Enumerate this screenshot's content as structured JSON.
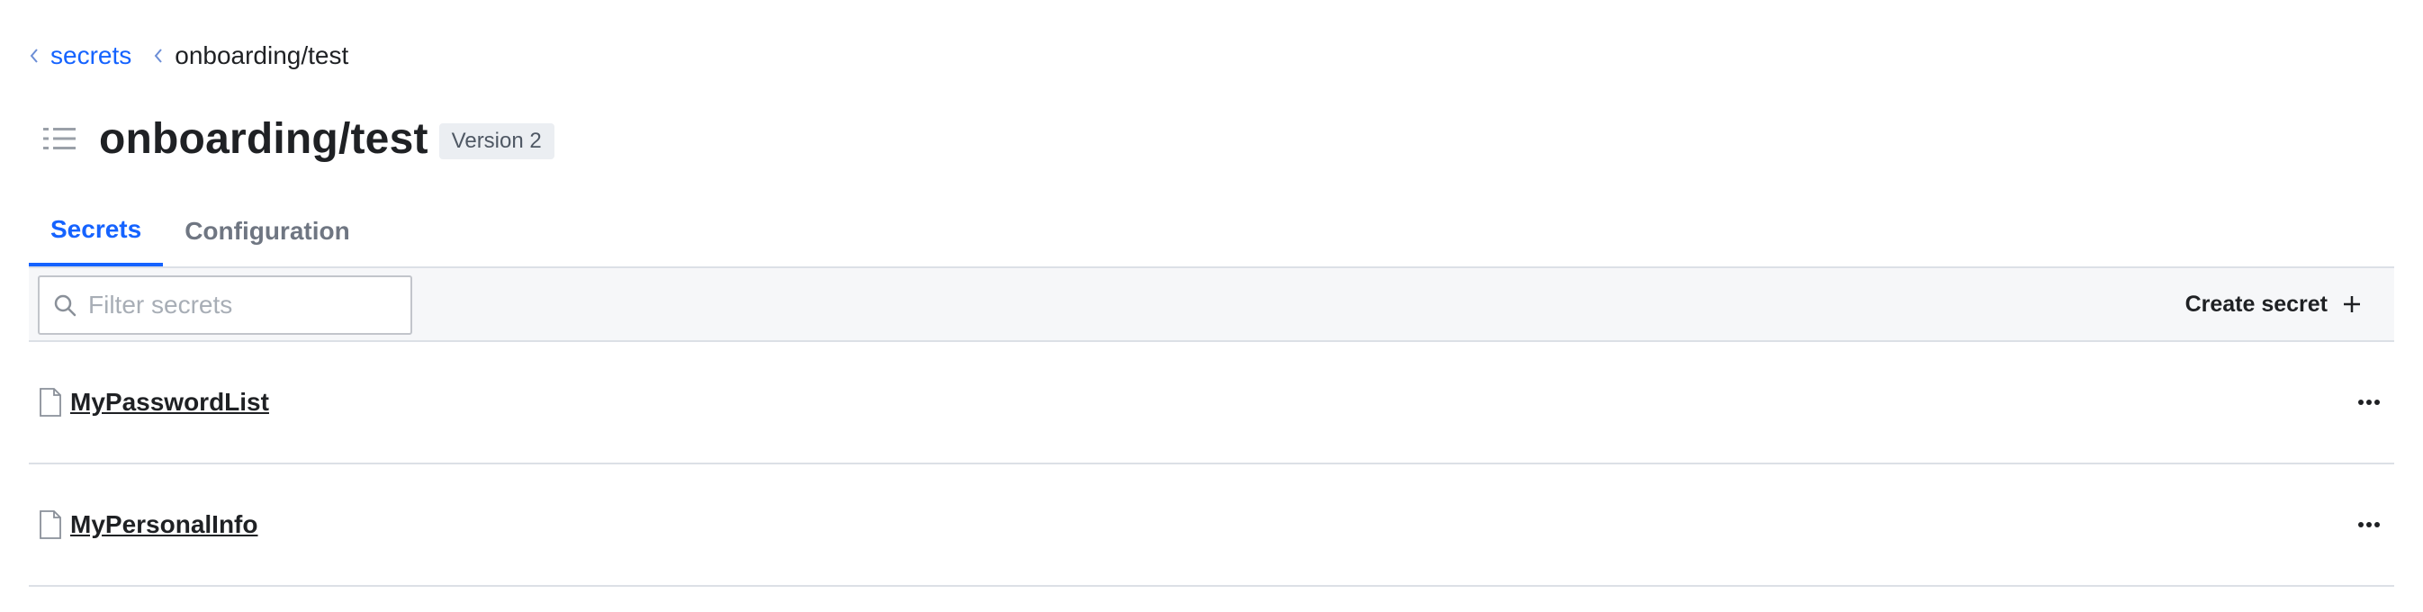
{
  "breadcrumb": {
    "items": [
      {
        "label": "secrets",
        "link": true
      },
      {
        "label": "onboarding/test",
        "link": false
      }
    ]
  },
  "header": {
    "title": "onboarding/test",
    "version_badge": "Version 2",
    "icon": "list-icon"
  },
  "tabs": [
    {
      "label": "Secrets",
      "active": true
    },
    {
      "label": "Configuration",
      "active": false
    }
  ],
  "toolbar": {
    "search_placeholder": "Filter secrets",
    "search_value": "",
    "create_label": "Create secret",
    "create_icon": "plus-icon"
  },
  "secrets": [
    {
      "name": "MyPasswordList",
      "icon": "file-icon"
    },
    {
      "name": "MyPersonalInfo",
      "icon": "file-icon"
    }
  ],
  "colors": {
    "accent": "#1563ff",
    "text": "#1f2124",
    "muted": "#6f7682",
    "border": "#dce0e6",
    "toolbar_bg": "#f6f7f9"
  }
}
